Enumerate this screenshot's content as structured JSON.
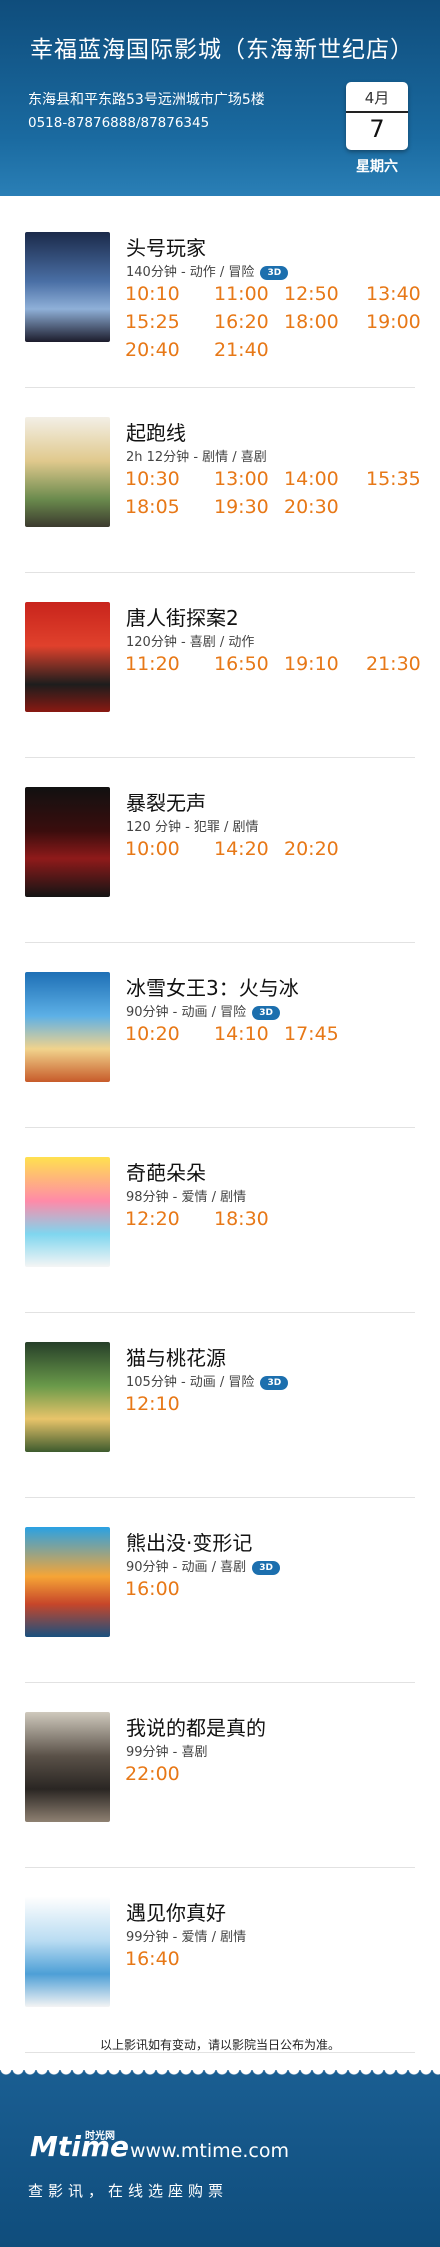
{
  "header": {
    "cinema_name": "幸福蓝海国际影城（东海新世纪店）",
    "address": "东海县和平东路53号远洲城市广场5楼",
    "phone": "0518-87876888/87876345",
    "date": {
      "month": "4月",
      "day": "7",
      "weekday": "星期六"
    }
  },
  "movies": [
    {
      "title": "头号玩家",
      "meta": "140分钟 - 动作 / 冒险",
      "is3d": true,
      "tag": "3D",
      "times": [
        "10:10",
        "11:00",
        "12:50",
        "13:40",
        "15:25",
        "16:20",
        "18:00",
        "19:00",
        "20:40",
        "21:40"
      ]
    },
    {
      "title": "起跑线",
      "meta": "2h 12分钟 - 剧情 / 喜剧",
      "is3d": false,
      "tag": "",
      "times": [
        "10:30",
        "13:00",
        "14:00",
        "15:35",
        "18:05",
        "19:30",
        "20:30"
      ]
    },
    {
      "title": "唐人街探案2",
      "meta": "120分钟 - 喜剧 / 动作",
      "is3d": false,
      "tag": "",
      "times": [
        "11:20",
        "16:50",
        "19:10",
        "21:30"
      ]
    },
    {
      "title": "暴裂无声",
      "meta": "120 分钟 - 犯罪 / 剧情",
      "is3d": false,
      "tag": "",
      "times": [
        "10:00",
        "14:20",
        "20:20"
      ]
    },
    {
      "title": "冰雪女王3：火与冰",
      "meta": "90分钟 - 动画 / 冒险",
      "is3d": true,
      "tag": "3D",
      "times": [
        "10:20",
        "14:10",
        "17:45"
      ]
    },
    {
      "title": "奇葩朵朵",
      "meta": "98分钟 - 爱情 / 剧情",
      "is3d": false,
      "tag": "",
      "times": [
        "12:20",
        "18:30"
      ]
    },
    {
      "title": "猫与桃花源",
      "meta": "105分钟 - 动画 / 冒险",
      "is3d": true,
      "tag": "3D",
      "times": [
        "12:10"
      ]
    },
    {
      "title": "熊出没·变形记",
      "meta": "90分钟 - 动画 / 喜剧",
      "is3d": true,
      "tag": "3D",
      "times": [
        "16:00"
      ]
    },
    {
      "title": "我说的都是真的",
      "meta": "99分钟 - 喜剧",
      "is3d": false,
      "tag": "",
      "times": [
        "22:00"
      ]
    },
    {
      "title": "遇见你真好",
      "meta": "99分钟 - 爱情 / 剧情",
      "is3d": false,
      "tag": "",
      "times": [
        "16:40"
      ]
    }
  ],
  "notice": "以上影讯如有变动，请以影院当日公布为准。",
  "footer": {
    "logo_text": "Mtime",
    "logo_cn": "时光网",
    "site": "www.mtime.com",
    "slogan": "查影讯，在线选座购票"
  },
  "colors": {
    "brand_blue": "#0f4d7c",
    "time_orange": "#e77817",
    "badge_3d": "#1c6fae"
  }
}
